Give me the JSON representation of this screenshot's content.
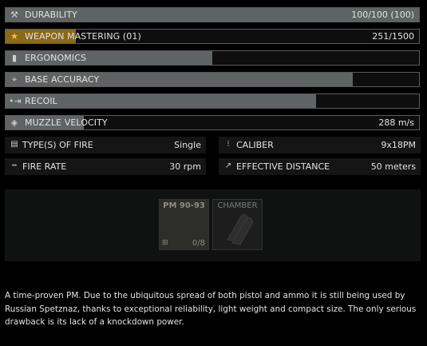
{
  "stats": [
    {
      "name": "stat-durability",
      "icon": "wrench-screwdriver-icon",
      "glyph": "⚒",
      "label": "DURABILITY",
      "value": "100/100 (100)",
      "level": 1.0,
      "fill_color": "#5f6364"
    },
    {
      "name": "stat-weapon-mastering",
      "icon": "mastering-star-icon",
      "glyph": "★",
      "label": "WEAPON MASTERING (01)",
      "value": "251/1500",
      "level": 0.17,
      "fill_color": "#8a6a18"
    },
    {
      "name": "stat-ergonomics",
      "icon": "ergonomics-icon",
      "glyph": "▮",
      "label": "ERGONOMICS",
      "value": "",
      "level": 0.5
    },
    {
      "name": "stat-base-accuracy",
      "icon": "crosshair-icon",
      "glyph": "⌖",
      "label": "BASE ACCURACY",
      "value": "",
      "level": 0.84
    },
    {
      "name": "stat-recoil",
      "icon": "recoil-icon",
      "glyph": "•⇥",
      "label": "RECOIL",
      "value": "",
      "level": 0.75
    },
    {
      "name": "stat-muzzle-velocity",
      "icon": "muzzle-velocity-icon",
      "glyph": "◈",
      "label": "MUZZLE VELOCITY",
      "value": "288 m/s",
      "level": 0.19
    }
  ],
  "fire": {
    "type_label": "TYPE(S) OF FIRE",
    "type_value": "Single",
    "rate_label": "FIRE RATE",
    "rate_value": "30 rpm"
  },
  "ballistics": {
    "caliber_label": "CALIBER",
    "caliber_value": "9x18PM",
    "distance_label": "EFFECTIVE DISTANCE",
    "distance_value": "50 meters"
  },
  "slots": {
    "magazine_title": "PM 90-93",
    "magazine_count": "0/8",
    "chamber_title": "CHAMBER"
  },
  "description": "A time-proven PM. Due to the ubiquitous spread of both pistol and ammo it is still being used by Russian Spetznaz, thanks to exceptional reliability, light weight and compact size. The only serious drawback is its lack of a knockdown power."
}
